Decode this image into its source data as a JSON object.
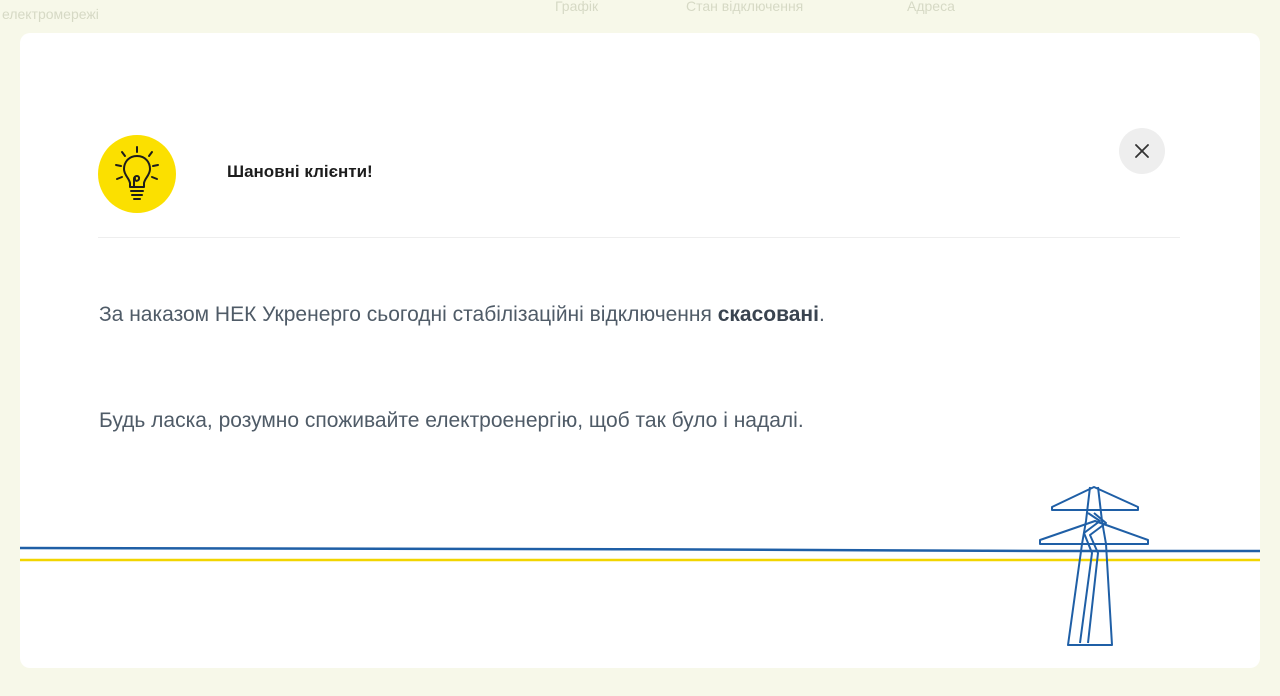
{
  "background": {
    "faded_items": [
      "Графік",
      "Стан відключення",
      "Адреса"
    ],
    "faded_corner": "електромережі"
  },
  "modal": {
    "title": "Шановні клієнти!",
    "message_line1_prefix": "За наказом НЕК Укренерго сьогодні стабілізаційні відключення ",
    "message_line1_bold": "скасовані",
    "message_line1_suffix": ".",
    "message_line2": "Будь ласка, розумно споживайте електроенергію, щоб так було і надалі.",
    "icons": {
      "bulb": "lightbulb-icon",
      "close": "close-icon",
      "tower": "power-tower-icon"
    }
  },
  "colors": {
    "accent_yellow": "#fbe000",
    "wire_blue": "#1f5fa6",
    "wire_yellow": "#f2d500",
    "text": "#4f5b67",
    "page_bg": "#f7f8e9"
  }
}
